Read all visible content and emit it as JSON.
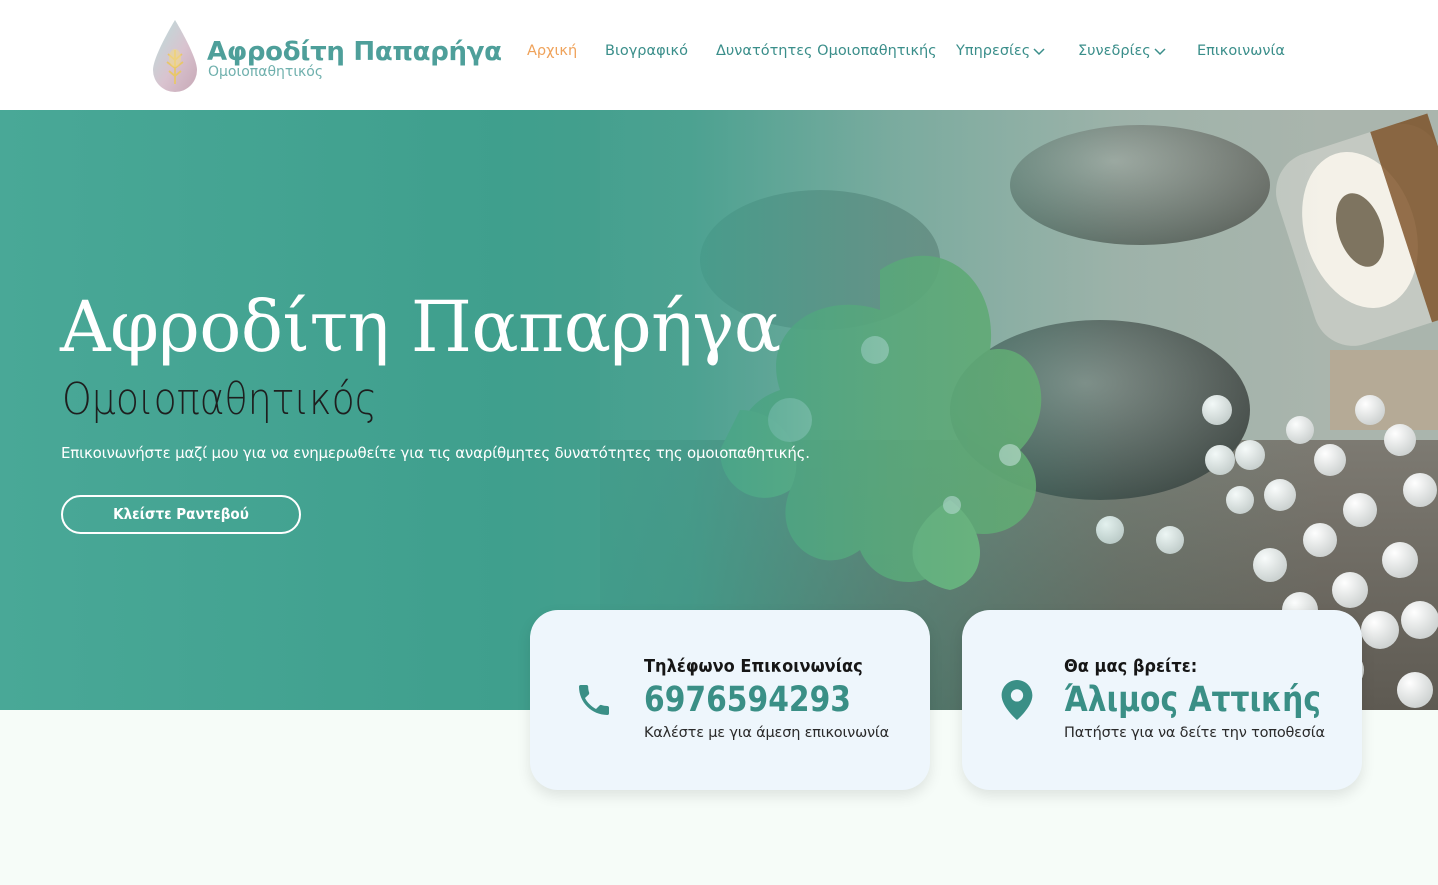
{
  "brand": {
    "name": "Αφροδίτη Παπαρήγα",
    "tagline": "Ομοιοπαθητικός"
  },
  "nav": {
    "items": [
      {
        "label": "Αρχική",
        "active": true,
        "dropdown": false
      },
      {
        "label": "Βιογραφικό",
        "active": false,
        "dropdown": false
      },
      {
        "label": "Δυνατότητες Ομοιοπαθητικής",
        "active": false,
        "dropdown": false
      },
      {
        "label": "Υπηρεσίες",
        "active": false,
        "dropdown": true
      },
      {
        "label": "Συνεδρίες",
        "active": false,
        "dropdown": true
      },
      {
        "label": "Επικοινωνία",
        "active": false,
        "dropdown": false
      }
    ]
  },
  "hero": {
    "title": "Αφροδίτη Παπαρήγα",
    "subtitle": "Ομοιοπαθητικός",
    "description": "Επικοινωνήστε μαζί μου για να ενημερωθείτε για τις αναρίθμητες δυνατότητες της ομοιοπαθητικής.",
    "cta_label": "Κλείστε Ραντεβού"
  },
  "cards": {
    "phone": {
      "icon": "phone-icon",
      "title": "Τηλέφωνο Επικοινωνίας",
      "value": "6976594293",
      "note": "Καλέστε με για άμεση επικοινωνία"
    },
    "location": {
      "icon": "map-pin-icon",
      "title": "Θα μας βρείτε:",
      "value": "Άλιμος Αττικής",
      "note": "Πατήστε για να δείτε την τοποθεσία"
    }
  },
  "colors": {
    "brand_teal": "#3a8e8a",
    "hero_teal": "#3f9f8d",
    "nav_active": "#efa25a",
    "card_bg": "#eef6fc",
    "card_value": "#3a8f86"
  }
}
